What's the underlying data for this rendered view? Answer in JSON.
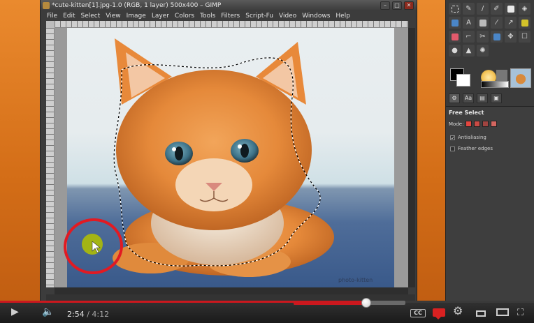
{
  "gimp": {
    "title": "*cute-kitten[1].jpg-1.0 (RGB, 1 layer) 500x400 – GIMP",
    "menu": [
      "File",
      "Edit",
      "Select",
      "View",
      "Image",
      "Layer",
      "Colors",
      "Tools",
      "Filters",
      "Script-Fu",
      "Video",
      "Windows",
      "Help"
    ],
    "watermark": "photo-kitten"
  },
  "toolbox": {
    "panel_title": "Free Select",
    "mode_label": "Mode:",
    "options": [
      {
        "label": "Antialiasing",
        "checked": true
      },
      {
        "label": "Feather edges",
        "checked": false
      }
    ],
    "dock_tabs": [
      "tool-options",
      "text",
      "document"
    ]
  },
  "player": {
    "current_time": "2:54",
    "separator": " / ",
    "duration": "4:12",
    "played_fraction": 0.69,
    "loaded_fraction": 0.72,
    "seek_fraction": 0.65,
    "cc_label": "CC",
    "icons": [
      "play-icon",
      "volume-icon",
      "gear-icon",
      "small-player-icon",
      "large-player-icon",
      "fullscreen-icon"
    ]
  },
  "colors": {
    "accent_red": "#cc181e",
    "annotation_red": "#e21a22"
  }
}
